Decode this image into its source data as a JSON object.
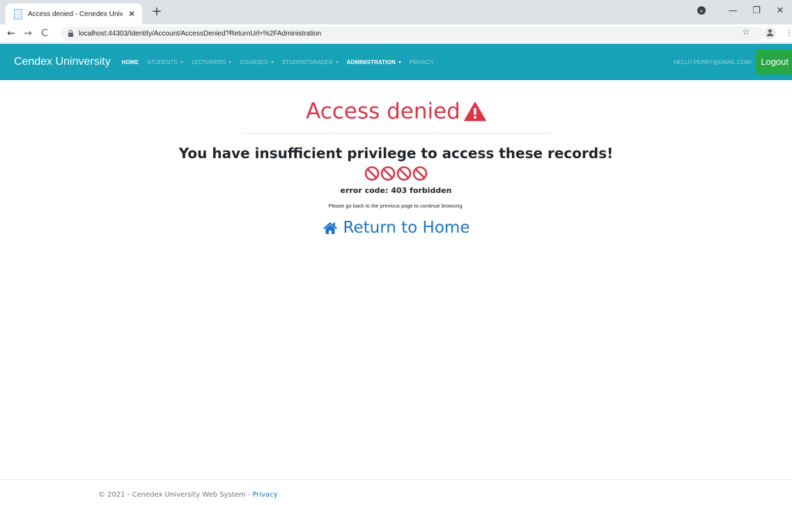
{
  "browser": {
    "tab_title": "Access denied - Cenedex Univers",
    "tab_close": "✕",
    "new_tab": "+",
    "url": "localhost:44303/Identity/Account/AccessDenied?ReturnUrl=%2FAdministration",
    "back": "←",
    "forward": "→",
    "reload": "C",
    "star": "☆",
    "menu": "⋮",
    "minimize": "—",
    "restore": "❐",
    "close": "✕"
  },
  "navbar": {
    "brand": "Cendex Uninversity",
    "items": [
      {
        "label": "HOME"
      },
      {
        "label": "STUDENTS"
      },
      {
        "label": "LECTURERS"
      },
      {
        "label": "COURSES"
      },
      {
        "label": "STUDENTGRADES"
      },
      {
        "label": "ADMINISTRATION"
      },
      {
        "label": "PRIVACY"
      }
    ],
    "greeting": "HELLO PERRY@GMAIL.COM!",
    "logout": "Logout",
    "color": "#17a2b8",
    "logout_color": "#28a745"
  },
  "main": {
    "heading": "Access denied",
    "heading_color": "#dc3545",
    "heading_icon": "warning-triangle-icon",
    "message": "You have insufficient privilege to access these records!",
    "forbidden_icons": [
      "no-entry-icon",
      "no-entry-icon",
      "no-entry-icon",
      "no-entry-icon"
    ],
    "error_code": "error code: 403 forbidden",
    "note": "Please go back to the previous page to continue browsing.",
    "return_link": "Return to Home",
    "return_icon": "home-icon",
    "link_color": "#1a73c8"
  },
  "footer": {
    "text": "© 2021 - Cenedex University Web System - ",
    "link": "Privacy"
  }
}
